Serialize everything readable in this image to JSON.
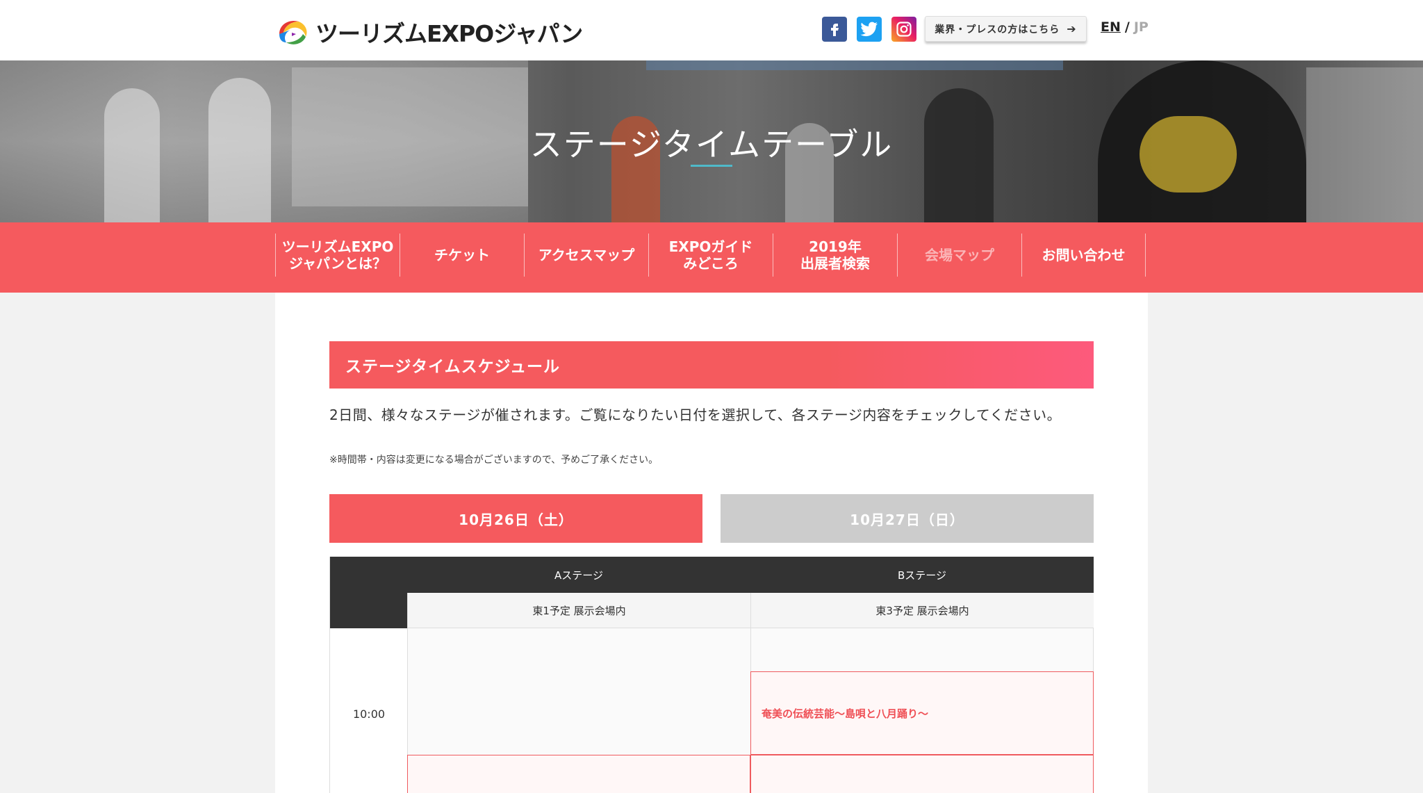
{
  "header": {
    "logo_text": "ツーリズムEXPOジャパン",
    "social": [
      {
        "name": "facebook-icon",
        "glyph": "f",
        "color": "#3b5998"
      },
      {
        "name": "twitter-icon",
        "glyph": "t",
        "color": "#1da1f2"
      },
      {
        "name": "instagram-icon",
        "glyph": "◎",
        "color": "#c13584"
      }
    ],
    "press_button": "業界・プレスの方はこちら",
    "lang_en": "EN",
    "lang_sep": "/",
    "lang_jp": "JP"
  },
  "hero": {
    "title": "ステージタイムテーブル",
    "accent_color": "#4fb9c9"
  },
  "nav": {
    "items": [
      {
        "label": "ツーリズムEXPO\nジャパンとは？",
        "enabled": true
      },
      {
        "label": "チケット",
        "enabled": true
      },
      {
        "label": "アクセスマップ",
        "enabled": true
      },
      {
        "label": "EXPOガイド\nみどころ",
        "enabled": true
      },
      {
        "label": "2019年\n出展者検索",
        "enabled": true
      },
      {
        "label": "会場マップ",
        "enabled": false
      },
      {
        "label": "お問い合わせ",
        "enabled": true
      }
    ],
    "color": "#f55a5e"
  },
  "main": {
    "section_title": "ステージタイムスケジュール",
    "lead": "2日間、様々なステージが催されます。ご覧になりたい日付を選択して、各ステージ内容をチェックしてください。",
    "note": "※時間帯・内容は変更になる場合がございますので、予めご了承ください。",
    "date_tabs": [
      {
        "label": "10月26日（土）",
        "active": true
      },
      {
        "label": "10月27日（日）",
        "active": false
      }
    ],
    "table": {
      "stages": [
        {
          "name": "Aステージ",
          "location": "東1予定 展示会場内"
        },
        {
          "name": "Bステージ",
          "location": "東3予定 展示会場内"
        }
      ],
      "time_slots": [
        "10:00"
      ],
      "events": {
        "b_stage_first": "奄美の伝統芸能〜島唄と八月踊り〜"
      }
    }
  }
}
